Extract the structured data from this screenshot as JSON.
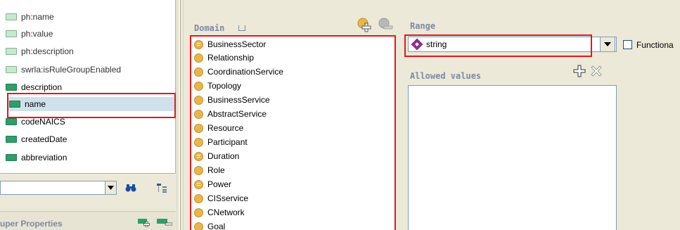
{
  "properties": {
    "items": [
      {
        "label": "ph:name",
        "kind": "annotation"
      },
      {
        "label": "ph:value",
        "kind": "annotation"
      },
      {
        "label": "ph:description",
        "kind": "annotation"
      },
      {
        "label": "swrla:isRuleGroupEnabled",
        "kind": "annotation"
      },
      {
        "label": "description",
        "kind": "datatype"
      },
      {
        "label": "name",
        "kind": "datatype",
        "selected": true
      },
      {
        "label": "codeNAICS",
        "kind": "datatype"
      },
      {
        "label": "createdDate",
        "kind": "datatype"
      },
      {
        "label": "abbreviation",
        "kind": "datatype"
      }
    ],
    "filter_value": "",
    "find_icon": "binoculars-icon",
    "hierarchy_icon": "hierarchy-icon"
  },
  "super_properties": {
    "label": "uper Properties",
    "add_icon": "add-super-property-icon",
    "remove_icon": "remove-super-property-icon"
  },
  "domain": {
    "label": "Domain",
    "sort_icon": "sort-icon",
    "add_icon": "add-class-icon",
    "remove_icon": "remove-class-icon",
    "items": [
      {
        "label": "BusinessSector",
        "defined": true
      },
      {
        "label": "Relationship",
        "defined": false
      },
      {
        "label": "CoordinationService",
        "defined": false
      },
      {
        "label": "Topology",
        "defined": false
      },
      {
        "label": "BusinessService",
        "defined": false
      },
      {
        "label": "AbstractService",
        "defined": false
      },
      {
        "label": "Resource",
        "defined": false
      },
      {
        "label": "Participant",
        "defined": false
      },
      {
        "label": "Duration",
        "defined": true
      },
      {
        "label": "Role",
        "defined": false
      },
      {
        "label": "Power",
        "defined": true
      },
      {
        "label": "CISservice",
        "defined": false
      },
      {
        "label": "CNetwork",
        "defined": false
      },
      {
        "label": "Goal",
        "defined": false
      }
    ]
  },
  "range": {
    "label": "Range",
    "value": "string",
    "value_icon": "datatype-icon",
    "functional_label": "Functiona",
    "functional_checked": false
  },
  "allowed_values": {
    "label": "Allowed values",
    "add_icon": "add-value-icon",
    "remove_icon": "remove-value-icon",
    "items": []
  },
  "colors": {
    "highlight": "#e2171f",
    "panel_bg": "#ece9d8",
    "header_text": "#7d89a5",
    "class_icon": "#e9b54d",
    "datatype_prop_icon": "#2e9e6a",
    "selection": "#cfe1ea"
  }
}
